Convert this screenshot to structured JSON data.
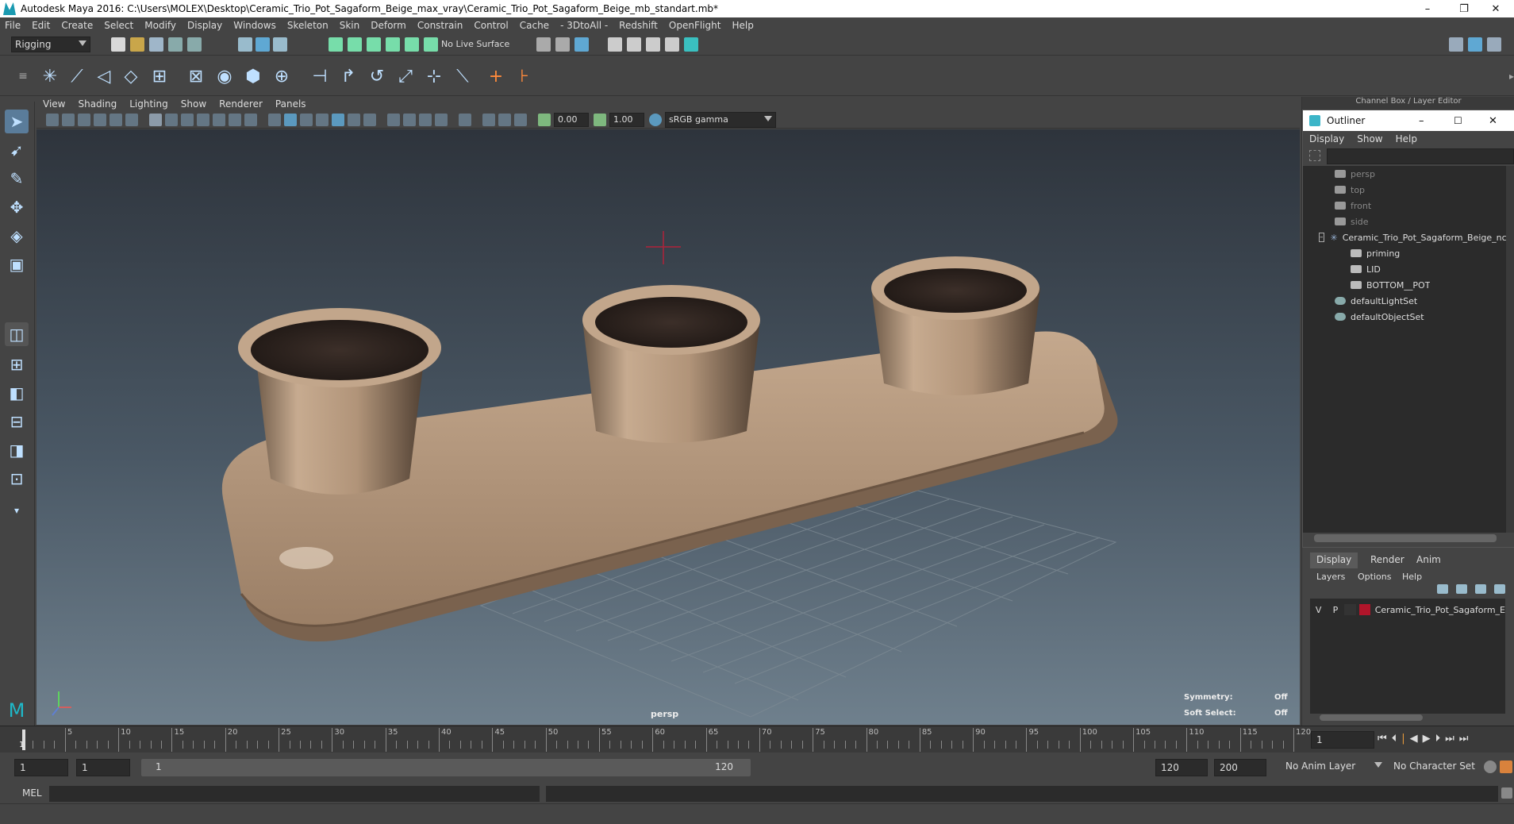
{
  "window": {
    "title": "Autodesk Maya 2016: C:\\Users\\MOLEX\\Desktop\\Ceramic_Trio_Pot_Sagaform_Beige_max_vray\\Ceramic_Trio_Pot_Sagaform_Beige_mb_standart.mb*",
    "minimize": "–",
    "restore": "❐",
    "close": "✕"
  },
  "menubar": [
    "File",
    "Edit",
    "Create",
    "Select",
    "Modify",
    "Display",
    "Windows",
    "Skeleton",
    "Skin",
    "Deform",
    "Constrain",
    "Control",
    "Cache",
    "- 3DtoAll -",
    "Redshift",
    "OpenFlight",
    "Help"
  ],
  "statusline": {
    "mode": "Rigging",
    "live_surface": "No Live Surface"
  },
  "viewport": {
    "menu": [
      "View",
      "Shading",
      "Lighting",
      "Show",
      "Renderer",
      "Panels"
    ],
    "exposure": "0.00",
    "gamma": "1.00",
    "colorspace": "sRGB gamma",
    "camera_label": "persp",
    "symmetry_label": "Symmetry:",
    "symmetry_value": "Off",
    "softselect_label": "Soft Select:",
    "softselect_value": "Off"
  },
  "timeline": {
    "current_frame": "1",
    "ticks": [
      "1",
      "5",
      "10",
      "15",
      "20",
      "25",
      "30",
      "35",
      "40",
      "45",
      "50",
      "55",
      "60",
      "65",
      "70",
      "75",
      "80",
      "85",
      "90",
      "95",
      "100",
      "105",
      "110",
      "115",
      "120"
    ],
    "frame_field": "1"
  },
  "range": {
    "start": "1",
    "start2": "1",
    "range_start": "1",
    "range_end": "120",
    "end": "120",
    "end2": "200",
    "anim_layer": "No Anim Layer",
    "char_set": "No Character Set"
  },
  "cmdline": {
    "label": "MEL"
  },
  "channelbox": {
    "title": "Channel Box / Layer Editor"
  },
  "outliner": {
    "title": "Outliner",
    "menu": [
      "Display",
      "Show",
      "Help"
    ],
    "items": [
      {
        "label": "persp"
      },
      {
        "label": "top"
      },
      {
        "label": "front"
      },
      {
        "label": "side"
      },
      {
        "label": "Ceramic_Trio_Pot_Sagaform_Beige_nc"
      },
      {
        "label": "priming"
      },
      {
        "label": "LID"
      },
      {
        "label": "BOTTOM__POT"
      },
      {
        "label": "defaultLightSet"
      },
      {
        "label": "defaultObjectSet"
      }
    ]
  },
  "layers": {
    "tabs": [
      "Display",
      "Render",
      "Anim"
    ],
    "menu": [
      "Layers",
      "Options",
      "Help"
    ],
    "row": {
      "v": "V",
      "p": "P",
      "name": "Ceramic_Trio_Pot_Sagaform_E"
    }
  },
  "colors": {
    "layer_color": "#b0152a",
    "accent": "#5fa8d3"
  }
}
